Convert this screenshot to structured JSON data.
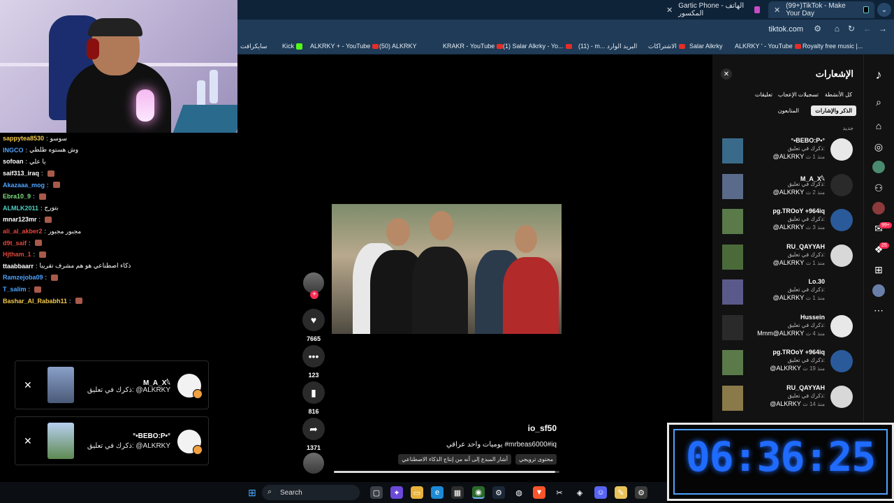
{
  "tabs": [
    {
      "label": "Gartic Phone - الهاتف المكسور",
      "active": false
    },
    {
      "label": "(99+)TikTok - Make Your Day",
      "active": true
    }
  ],
  "address": {
    "url": "tiktok.com"
  },
  "bookmarks": [
    "سايكرافت",
    "Kick",
    "ALKRKY + - YouTube",
    "(50) ALKRKY",
    "KRAKR - YouTube",
    "(1) Salar Alkrky - Yo...",
    "(11) - m... البريد الوارد",
    "الاشتراكات",
    "Salar Alkrky",
    "ALKRKY ' - YouTube",
    "Royalty free music |..."
  ],
  "chat": [
    {
      "user": "sappytea8530",
      "msg": "سوسو",
      "color": "#f2c94c"
    },
    {
      "user": "INGCO",
      "msg": "وش هستوه طلطي",
      "color": "#4fa3ff"
    },
    {
      "user": "sofoan",
      "msg": "يا علي",
      "color": "#ffffff"
    },
    {
      "user": "saif313_iraq",
      "msg": "",
      "color": "#ffffff"
    },
    {
      "user": "Akazaaa_mog",
      "msg": "",
      "color": "#4fa3ff"
    },
    {
      "user": "Ebra10_9",
      "msg": "",
      "color": "#7ee081"
    },
    {
      "user": "ALMLK2011",
      "msg": "بتورج",
      "color": "#4fd1c5"
    },
    {
      "user": "mnar123mr",
      "msg": "",
      "color": "#ffffff"
    },
    {
      "user": "ali_al_akber2",
      "msg": "مجبور مجبور",
      "color": "#e0483e"
    },
    {
      "user": "d9t_saif",
      "msg": "",
      "color": "#e0483e"
    },
    {
      "user": "Hjtham_1",
      "msg": "",
      "color": "#e0483e"
    },
    {
      "user": "ttaabbaarr",
      "msg": "ذكاء اصطناعي هو هم مشرف تقريبا",
      "color": "#ffffff"
    },
    {
      "user": "Ramzejoba09",
      "msg": "",
      "color": "#4fa3ff"
    },
    {
      "user": "T_salim",
      "msg": "",
      "color": "#4fa3ff"
    },
    {
      "user": "Bashar_Al_Rababh11",
      "msg": "",
      "color": "#f2c94c"
    }
  ],
  "notif_cards": [
    {
      "name": "M_A_X𓆩",
      "text": "ذكرك في تعليق: @ALKRKY",
      "thumb_color": "#6a7fa8"
    },
    {
      "name": "°•BEBO:P•°",
      "text": "ذكرك في تعليق: @ALKRKY",
      "thumb_color": "#5e8a52"
    }
  ],
  "video": {
    "author": "io_sf50",
    "caption": "يوميات واحد عراقي #mrbeas6000#iq",
    "tags": [
      "محتوى ترويجي",
      "أشار المبدع إلى أنه من إنتاج الذكاء الاصطناعي"
    ],
    "likes": "7665",
    "comments": "123",
    "saves": "816",
    "shares": "1371",
    "progress": 0.98
  },
  "panel": {
    "title": "الإشعارات",
    "filters": [
      "كل الأنشطة",
      "تسجيلات الإعجاب",
      "تعليقات",
      "الذكر والإشارات",
      "المتابعون"
    ],
    "new_label": "جديد",
    "items": [
      {
        "name": "°•BEBO:P•°",
        "action": "ذكرك في تعليق:",
        "sub": "@ALKRKY",
        "time": "منذ 1 ث"
      },
      {
        "name": "M_A_X𓆩",
        "action": "ذكرك في تعليق:",
        "sub": "@ALKRKY",
        "time": "منذ 2 ث"
      },
      {
        "name": "pg.TROoY +964iq",
        "action": "ذكرك في تعليق:",
        "sub": "@ALKRKY",
        "time": "منذ 3 ث"
      },
      {
        "name": "RU_QAYYAH",
        "action": "ذكرك في تعليق:",
        "sub": "@ALKRKY",
        "time": "منذ 1 ث"
      },
      {
        "name": "Lo.30",
        "action": "ذكرك في تعليق:",
        "sub": "@ALKRKY",
        "time": "منذ 1 ث"
      },
      {
        "name": "Hussein",
        "action": "ذكرك في تعليق:",
        "sub": "Mmm@ALKRKY",
        "time": "منذ 4 ث"
      },
      {
        "name": "pg.TROoY +964iq",
        "action": "ذكرك في تعليق:",
        "sub": "@ALKRKY",
        "time": "منذ 19 ث"
      },
      {
        "name": "RU_QAYYAH",
        "action": "ذكرك في تعليق:",
        "sub": "@ALKRKY",
        "time": "منذ 14 ث"
      }
    ]
  },
  "sidebar": {
    "badge_inbox": "99+",
    "badge_activity": "25"
  },
  "clock": {
    "time": "06:36:25"
  },
  "taskbar": {
    "search_label": "Search"
  }
}
